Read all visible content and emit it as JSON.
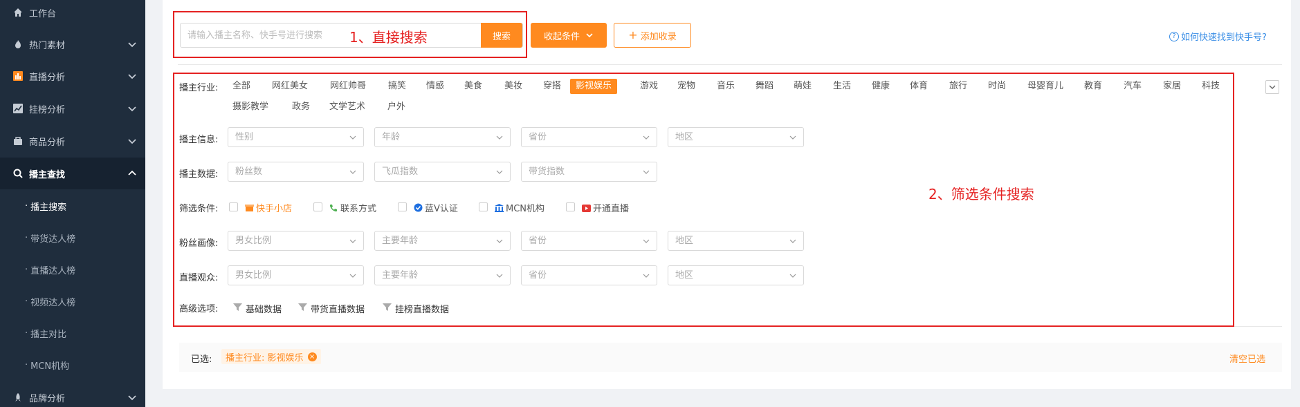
{
  "sidebar": {
    "items": [
      {
        "label": "工作台",
        "icon": "home-icon"
      },
      {
        "label": "热门素材",
        "icon": "flame-icon"
      },
      {
        "label": "直播分析",
        "icon": "bar-chart-icon"
      },
      {
        "label": "挂榜分析",
        "icon": "line-chart-icon"
      },
      {
        "label": "商品分析",
        "icon": "bag-icon"
      },
      {
        "label": "播主查找",
        "icon": "search-icon"
      },
      {
        "label": "品牌分析",
        "icon": "rocket-icon"
      }
    ],
    "sub_items": [
      {
        "label": "播主搜索"
      },
      {
        "label": "带货达人榜"
      },
      {
        "label": "直播达人榜"
      },
      {
        "label": "视频达人榜"
      },
      {
        "label": "播主对比"
      },
      {
        "label": "MCN机构"
      }
    ]
  },
  "search": {
    "placeholder": "请输入播主名称、快手号进行搜索",
    "button": "搜索",
    "collapse_button": "收起条件",
    "add_button": "添加收录",
    "help_link": "如何快速找到快手号?"
  },
  "filters": {
    "industry_label": "播主行业:",
    "industries": [
      "全部",
      "网红美女",
      "网红帅哥",
      "搞笑",
      "情感",
      "美食",
      "美妆",
      "穿搭",
      "影视娱乐",
      "游戏",
      "宠物",
      "音乐",
      "舞蹈",
      "萌娃",
      "生活",
      "健康",
      "体育",
      "旅行",
      "时尚",
      "母婴育儿",
      "教育",
      "汽车",
      "家居",
      "科技",
      "摄影教学",
      "政务",
      "文学艺术",
      "户外"
    ],
    "industry_selected": "影视娱乐",
    "info_label": "播主信息:",
    "info_dropdowns": [
      "性别",
      "年龄",
      "省份",
      "地区"
    ],
    "data_label": "播主数据:",
    "data_dropdowns": [
      "粉丝数",
      "飞瓜指数",
      "带货指数"
    ],
    "cond_label": "筛选条件:",
    "conditions": [
      {
        "label": "快手小店",
        "icon": "shop-icon",
        "color": "#ff8a1f"
      },
      {
        "label": "联系方式",
        "icon": "phone-icon",
        "color": "#4caf50"
      },
      {
        "label": "蓝V认证",
        "icon": "verified-icon",
        "color": "#1e6fe0"
      },
      {
        "label": "MCN机构",
        "icon": "institution-icon",
        "color": "#1e6fe0"
      },
      {
        "label": "开通直播",
        "icon": "live-tv-icon",
        "color": "#e53935"
      }
    ],
    "fans_label": "粉丝画像:",
    "fans_dropdowns": [
      "男女比例",
      "主要年龄",
      "省份",
      "地区"
    ],
    "viewers_label": "直播观众:",
    "viewers_dropdowns": [
      "男女比例",
      "主要年龄",
      "省份",
      "地区"
    ],
    "advanced_label": "高级选项:",
    "advanced": [
      "基础数据",
      "带货直播数据",
      "挂榜直播数据"
    ]
  },
  "selected": {
    "label": "已选:",
    "chip": "播主行业: 影视娱乐",
    "clear": "清空已选"
  },
  "annotations": {
    "first": "1、直接搜索",
    "second": "2、筛选条件搜索",
    "color": "#e52222"
  },
  "colors": {
    "accent": "#ff8a1f",
    "sidebar_bg": "#1f2d3d",
    "link": "#3a8ee6"
  }
}
